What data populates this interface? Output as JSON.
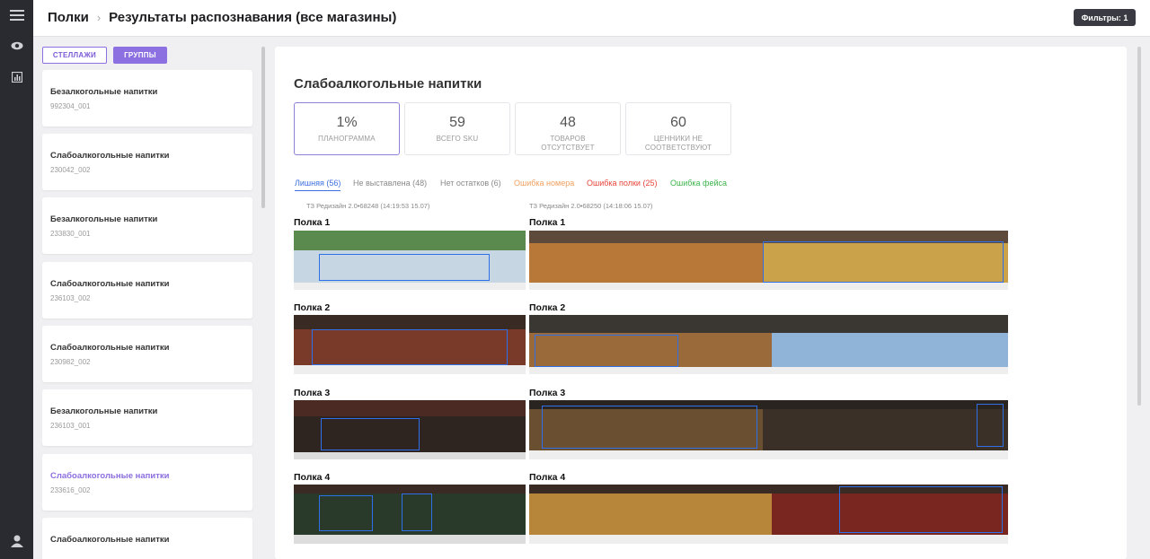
{
  "header": {
    "crumb_root": "Полки",
    "crumb_page": "Результаты распознавания (все магазины)",
    "filters_label": "Фильтры: 1"
  },
  "left": {
    "toggle_racks": "СТЕЛЛАЖИ",
    "toggle_groups": "ГРУППЫ",
    "cards": [
      {
        "title": "Безалкогольные напитки",
        "code": "992304_001"
      },
      {
        "title": "Слабоалкогольные напитки",
        "code": "230042_002"
      },
      {
        "title": "Безалкогольные напитки",
        "code": "233830_001"
      },
      {
        "title": "Слабоалкогольные напитки",
        "code": "236103_002"
      },
      {
        "title": "Слабоалкогольные напитки",
        "code": "230982_002"
      },
      {
        "title": "Безалкогольные напитки",
        "code": "236103_001"
      },
      {
        "title": "Слабоалкогольные напитки",
        "code": "233616_002"
      },
      {
        "title": "Слабоалкогольные напитки",
        "code": ""
      }
    ]
  },
  "main": {
    "title": "Слабоалкогольные напитки",
    "stats": [
      {
        "value": "1%",
        "label": "ПЛАНОГРАММА"
      },
      {
        "value": "59",
        "label": "ВСЕГО SKU"
      },
      {
        "value": "48",
        "label": "ТОВАРОВ ОТСУТСТВУЕТ"
      },
      {
        "value": "60",
        "label": "ЦЕННИКИ НЕ СООТВЕТСТВУЮТ"
      }
    ],
    "tabs": [
      {
        "label": "Лишняя (56)",
        "color": "#3d6fe0"
      },
      {
        "label": "Не выставлена (48)",
        "color": "#8a8a8a"
      },
      {
        "label": "Нет остатков (6)",
        "color": "#8a8a8a"
      },
      {
        "label": "Ошибка номера",
        "color": "#f0a060"
      },
      {
        "label": "Ошибка полки (25)",
        "color": "#e8443a"
      },
      {
        "label": "Ошибка фейса",
        "color": "#3cb44a"
      }
    ],
    "col_left_caption": "ТЗ Редизайн 2.0•68248 (14:19:53 15.07)",
    "col_right_caption": "ТЗ Редизайн 2.0•68250 (14:18:06 15.07)",
    "shelves": [
      "Полка 1",
      "Полка 2",
      "Полка 3",
      "Полка 4"
    ]
  },
  "colors": {
    "accent": "#8c6fe0",
    "box": "#2f6fe8",
    "rail": "#2a2b30"
  },
  "icons": [
    "menu-icon",
    "eye-icon",
    "chart-icon",
    "user-icon"
  ]
}
